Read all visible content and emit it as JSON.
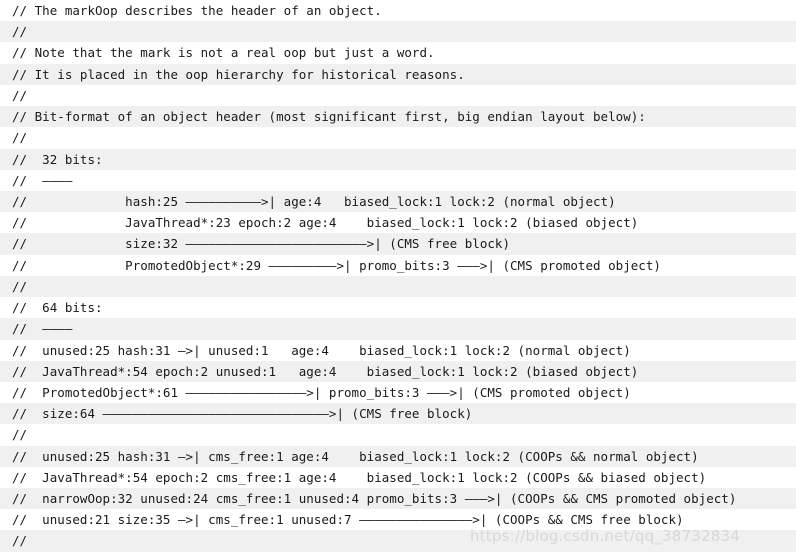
{
  "document": {
    "kind": "source-code-comment-block",
    "language": "cpp",
    "background_color": "#ffffff",
    "stripe_color": "#f0f0f0",
    "text_color": "#1a1a1a",
    "watermark": "https://blog.csdn.net/qq_38732834",
    "watermark_color": "#d8d8d8",
    "lines": [
      "// The markOop describes the header of an object.",
      "//",
      "// Note that the mark is not a real oop but just a word.",
      "// It is placed in the oop hierarchy for historical reasons.",
      "//",
      "// Bit-format of an object header (most significant first, big endian layout below):",
      "//",
      "//  32 bits:",
      "//  ————",
      "//             hash:25 ——————————>| age:4   biased_lock:1 lock:2 (normal object)",
      "//             JavaThread*:23 epoch:2 age:4    biased_lock:1 lock:2 (biased object)",
      "//             size:32 ————————————————————————>| (CMS free block)",
      "//             PromotedObject*:29 —————————>| promo_bits:3 ———>| (CMS promoted object)",
      "//",
      "//  64 bits:",
      "//  ————",
      "//  unused:25 hash:31 —>| unused:1   age:4    biased_lock:1 lock:2 (normal object)",
      "//  JavaThread*:54 epoch:2 unused:1   age:4    biased_lock:1 lock:2 (biased object)",
      "//  PromotedObject*:61 ————————————————>| promo_bits:3 ———>| (CMS promoted object)",
      "//  size:64 ——————————————————————————————>| (CMS free block)",
      "//",
      "//  unused:25 hash:31 —>| cms_free:1 age:4    biased_lock:1 lock:2 (COOPs && normal object)",
      "//  JavaThread*:54 epoch:2 cms_free:1 age:4    biased_lock:1 lock:2 (COOPs && biased object)",
      "//  narrowOop:32 unused:24 cms_free:1 unused:4 promo_bits:3 ———>| (COOPs && CMS promoted object)",
      "//  unused:21 size:35 —>| cms_free:1 unused:7 ———————————————>| (COOPs && CMS free block)",
      "//"
    ]
  }
}
